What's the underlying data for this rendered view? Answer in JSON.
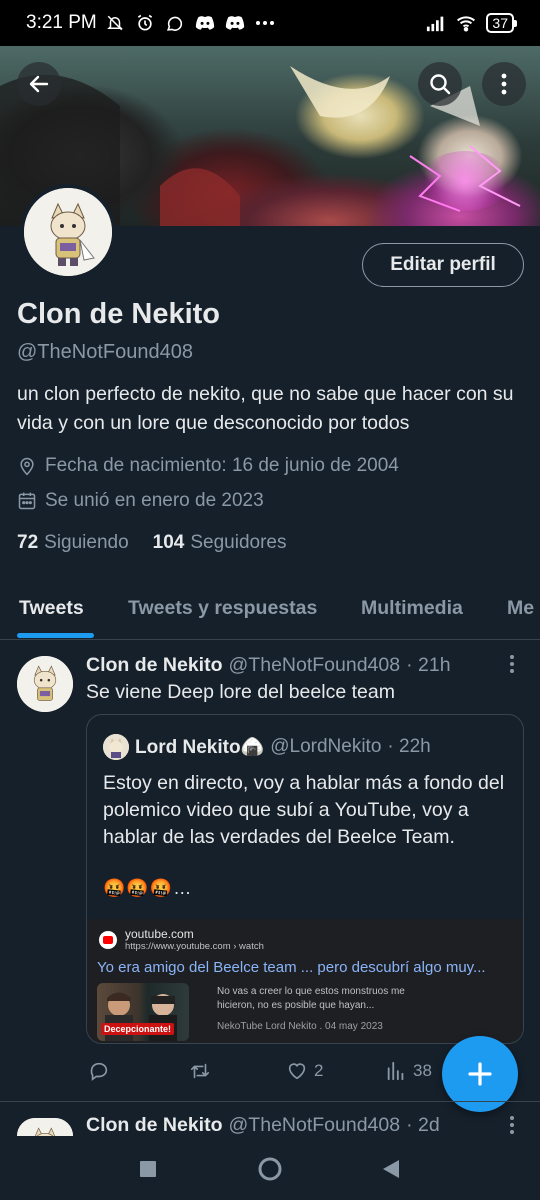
{
  "status_bar": {
    "time": "3:21 PM",
    "battery": "37",
    "left_icons": [
      "muted-bell-icon",
      "alarm-icon",
      "whatsapp-icon",
      "discord-icon",
      "discord-icon",
      "more-dots-icon"
    ],
    "right_icons": [
      "signal-icon",
      "wifi-icon",
      "battery-icon"
    ]
  },
  "header": {
    "back_icon": "arrow-left-icon",
    "search_icon": "search-icon",
    "more_icon": "more-vertical-icon"
  },
  "profile": {
    "edit_label": "Editar perfil",
    "name": "Clon de Nekito",
    "handle": "@TheNotFound408",
    "bio": "un clon perfecto de nekito, que no sabe que hacer con su vida y con un lore que desconocido por todos",
    "birth": "Fecha de nacimiento: 16 de junio de 2004",
    "joined": "Se unió en enero de 2023",
    "following_count": "72",
    "following_label": "Siguiendo",
    "followers_count": "104",
    "followers_label": "Seguidores"
  },
  "tabs": [
    {
      "label": "Tweets",
      "active": true
    },
    {
      "label": "Tweets y respuestas",
      "active": false
    },
    {
      "label": "Multimedia",
      "active": false
    },
    {
      "label": "Me",
      "active": false
    }
  ],
  "tweets": [
    {
      "name": "Clon de Nekito",
      "handle": "@TheNotFound408",
      "time": "· 21h",
      "text": "Se viene Deep lore del beelce team",
      "quote": {
        "name": "Lord Nekito🍙",
        "handle": "@LordNekito",
        "time": "· 22h",
        "text": "Estoy en directo, voy a hablar más a fondo del polemico video que subí a YouTube, voy a hablar de las verdades del Beelce Team.",
        "emoji": "🤬🤬🤬…",
        "link_card": {
          "domain": "youtube.com",
          "url": "https://www.youtube.com › watch",
          "title": "Yo era amigo del Beelce team ... pero descubrí algo muy...",
          "thumb_badge": "Decepcionante!",
          "snippet": "No vas a creer lo que estos monstruos me hicieron, no es posible que hayan...",
          "source": "NekoTube Lord Nekito . 04 may 2023"
        }
      },
      "actions": {
        "reply": "",
        "retweet": "",
        "likes": "2",
        "views": "38"
      }
    },
    {
      "name": "Clon de Nekito",
      "handle": "@TheNotFound408",
      "time": "· 2d"
    }
  ],
  "colors": {
    "background": "#15202b",
    "accent": "#1d9bf0",
    "secondary_text": "#8b98a5",
    "border": "#38444d"
  }
}
